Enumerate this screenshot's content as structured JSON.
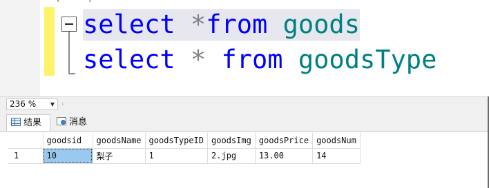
{
  "editor": {
    "top_fragment": "(—‐—) — ( —— ) ——",
    "line1": {
      "kw1": "select",
      "op": " *",
      "kw2": "from",
      "ident": "goods"
    },
    "line2": {
      "kw1": "select",
      "op": " * ",
      "kw2": "from",
      "ident": "goodsType"
    }
  },
  "toolbar": {
    "zoom_value": "236 %"
  },
  "tabs": [
    {
      "label": "结果",
      "icon": "grid-icon",
      "active": true
    },
    {
      "label": "消息",
      "icon": "messages-icon",
      "active": false
    }
  ],
  "results": {
    "columns": [
      "goodsid",
      "goodsName",
      "goodsTypeID",
      "goodsImg",
      "goodsPrice",
      "goodsNum"
    ],
    "rows": [
      {
        "rownum": "1",
        "cells": [
          "10",
          "梨子",
          "1",
          "2.jpg",
          "13.00",
          "14"
        ]
      }
    ],
    "selected_cell": {
      "row": 0,
      "col": 0
    },
    "colors": {
      "selection": "#99c9f0",
      "keyword": "#0000ff",
      "identifier": "#008080",
      "operator": "#808080",
      "change_bar": "#fff26b"
    }
  }
}
